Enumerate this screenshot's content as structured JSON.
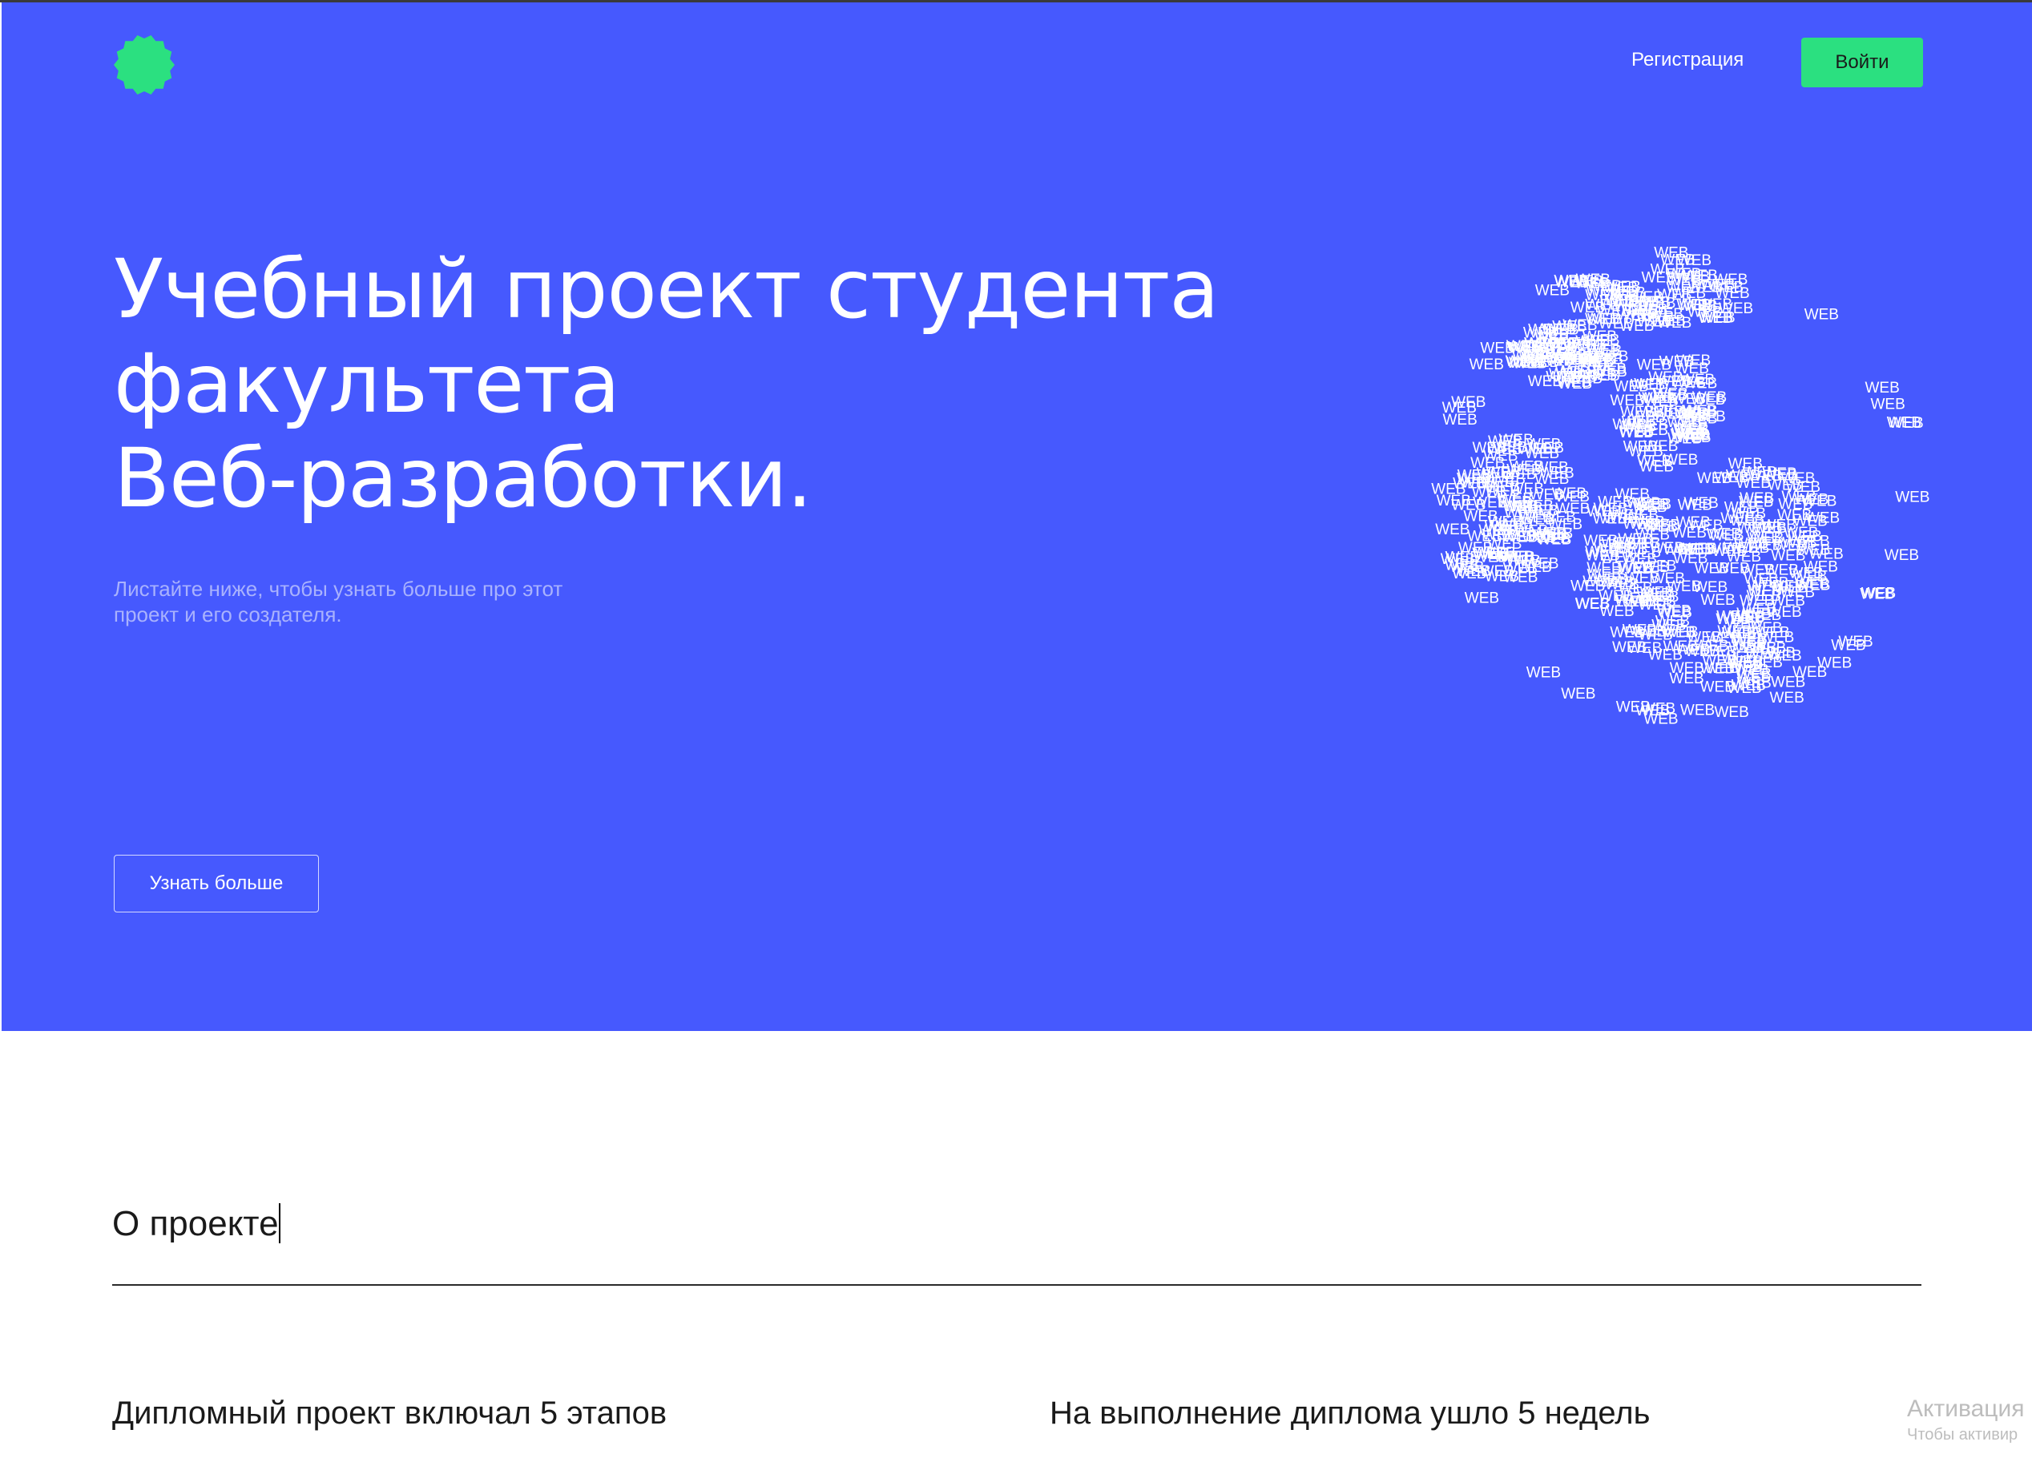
{
  "header": {
    "register_label": "Регистрация",
    "login_label": "Войти",
    "logo_icon": "green-rosette-logo-icon"
  },
  "hero": {
    "title_lines": [
      "Учебный проект студента",
      "факультета",
      "Веб-разработки."
    ],
    "subtitle": "Листайте ниже, чтобы узнать больше про этот проект и его создателя.",
    "cta_label": "Узнать больше",
    "globe_word": "WEB",
    "globe_icon": "web-word-globe-icon"
  },
  "about": {
    "title": "О проекте",
    "facts": [
      "Дипломный проект включал 5 этапов",
      "На выполнение диплома ушло 5 недель"
    ]
  },
  "system_watermark": {
    "title": "Активация",
    "subtitle": "Чтобы активир"
  },
  "colors": {
    "hero_background": "#4659fe",
    "accent_green": "#2be080",
    "subtitle_text": "#a9b2fd",
    "page_background": "#ffffff"
  }
}
